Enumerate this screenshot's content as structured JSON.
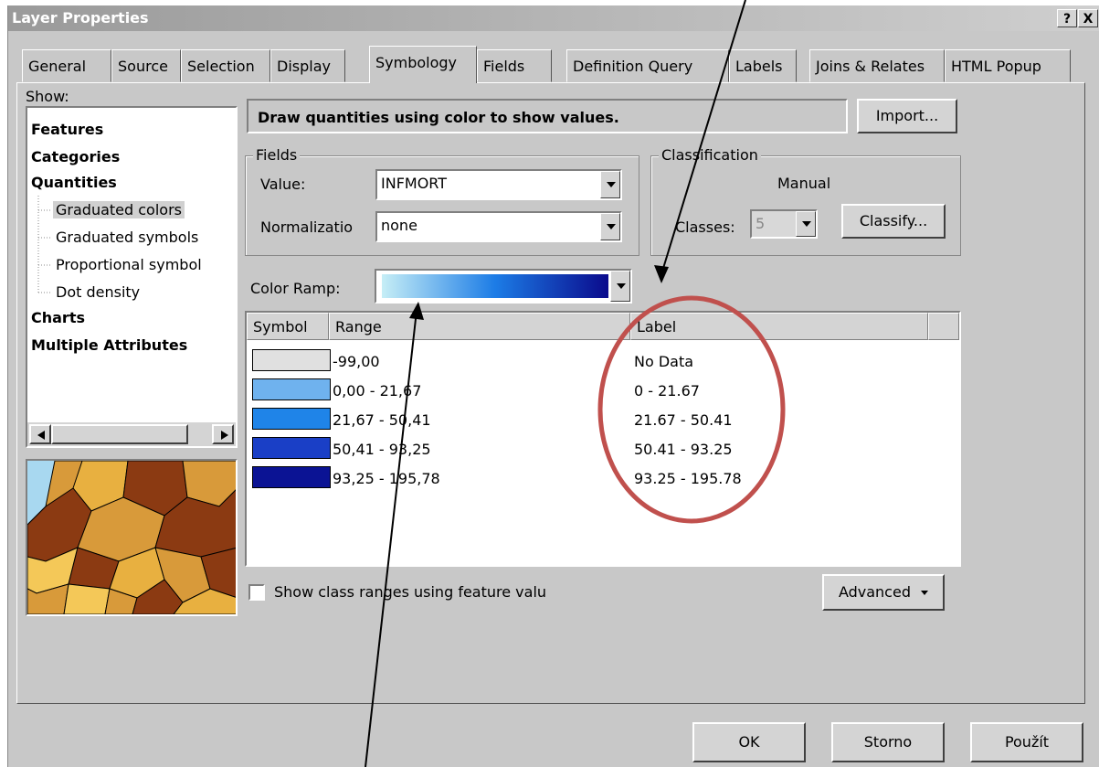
{
  "window": {
    "title": "Layer Properties",
    "help_label": "?",
    "close_label": "X"
  },
  "tabs": [
    {
      "label": "General"
    },
    {
      "label": "Source"
    },
    {
      "label": "Selection"
    },
    {
      "label": "Display"
    },
    {
      "label": "Symbology"
    },
    {
      "label": "Fields"
    },
    {
      "label": "Definition Query"
    },
    {
      "label": "Labels"
    },
    {
      "label": "Joins & Relates"
    },
    {
      "label": "HTML Popup"
    }
  ],
  "show": {
    "label": "Show:",
    "items": [
      {
        "label": "Features"
      },
      {
        "label": "Categories"
      },
      {
        "label": "Quantities"
      },
      {
        "label": "Graduated colors"
      },
      {
        "label": "Graduated symbols"
      },
      {
        "label": "Proportional symbol"
      },
      {
        "label": "Dot density"
      },
      {
        "label": "Charts"
      },
      {
        "label": "Multiple Attributes"
      }
    ]
  },
  "description": "Draw quantities using color to show values.",
  "import_label": "Import...",
  "fields": {
    "legend": "Fields",
    "value_label": "Value:",
    "value": "INFMORT",
    "normalization_label": "Normalizatio",
    "normalization": "none"
  },
  "classification": {
    "legend": "Classification",
    "method": "Manual",
    "classes_label": "Classes:",
    "classes_value": "5",
    "classify_label": "Classify..."
  },
  "color_ramp_label": "Color Ramp:",
  "color_ramp_stops": [
    "#c6eef6",
    "#1c7ce6",
    "#0a0a8c"
  ],
  "table": {
    "headers": {
      "symbol": "Symbol",
      "range": "Range",
      "label": "Label"
    },
    "rows": [
      {
        "color": "#e0e0e0",
        "range": "-99,00",
        "label": "No Data"
      },
      {
        "color": "#6fb2ee",
        "range": "0,00 - 21,67",
        "label": "0 - 21.67"
      },
      {
        "color": "#1f84e8",
        "range": "21,67 - 50,41",
        "label": "21.67 - 50.41"
      },
      {
        "color": "#1a3fc6",
        "range": "50,41 - 93,25",
        "label": "50.41 - 93.25"
      },
      {
        "color": "#0b1394",
        "range": "93,25 - 195,78",
        "label": "93.25 - 195.78"
      }
    ]
  },
  "show_class_ranges_label": "Show class ranges using feature valu",
  "advanced_label": "Advanced",
  "footer": {
    "ok": "OK",
    "cancel": "Storno",
    "apply": "Použít"
  }
}
